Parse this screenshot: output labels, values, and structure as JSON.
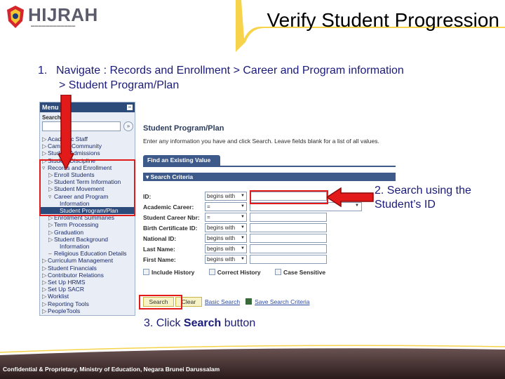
{
  "header": {
    "logo_text": "HIJRAH",
    "title": "Verify Student Progression"
  },
  "instruction": {
    "number": "1.",
    "prefix": "Navigate : ",
    "path_line1": "Records and Enrollment > Career and Program information",
    "path_line2": "> Student Program/Plan"
  },
  "menu": {
    "title": "Menu",
    "search_label": "Search:",
    "items": [
      {
        "marker": "▷",
        "label": "Academic Staff",
        "level": 0
      },
      {
        "marker": "▷",
        "label": "Campus Community",
        "level": 0
      },
      {
        "marker": "▷",
        "label": "Student Admissions",
        "level": 0
      },
      {
        "marker": "▷",
        "label": "Student Discipline",
        "level": 0
      },
      {
        "marker": "▿",
        "label": "Records and Enrollment",
        "level": 0
      },
      {
        "marker": "▷",
        "label": "Enroll Students",
        "level": 1
      },
      {
        "marker": "▷",
        "label": "Student Term Information",
        "level": 1
      },
      {
        "marker": "▷",
        "label": "Student Movement",
        "level": 1
      },
      {
        "marker": "▿",
        "label": "Career and Program",
        "level": 1
      },
      {
        "marker": "",
        "label": "Information",
        "level": 2
      },
      {
        "marker": "–",
        "label": "Student Program/Plan",
        "level": 2,
        "selected": true
      },
      {
        "marker": "▷",
        "label": "Enrollment Summaries",
        "level": 1
      },
      {
        "marker": "▷",
        "label": "Term Processing",
        "level": 1
      },
      {
        "marker": "▷",
        "label": "Graduation",
        "level": 1
      },
      {
        "marker": "▷",
        "label": "Student Background",
        "level": 1
      },
      {
        "marker": "",
        "label": "Information",
        "level": 2
      },
      {
        "marker": "–",
        "label": "Religious Education Details",
        "level": 1
      },
      {
        "marker": "▷",
        "label": "Curriculum Management",
        "level": 0
      },
      {
        "marker": "▷",
        "label": "Student Financials",
        "level": 0
      },
      {
        "marker": "▷",
        "label": "Contributor Relations",
        "level": 0
      },
      {
        "marker": "▷",
        "label": "Set Up HRMS",
        "level": 0
      },
      {
        "marker": "▷",
        "label": "Set Up SACR",
        "level": 0
      },
      {
        "marker": "▷",
        "label": "Worklist",
        "level": 0
      },
      {
        "marker": "▷",
        "label": "Reporting Tools",
        "level": 0
      },
      {
        "marker": "▷",
        "label": "PeopleTools",
        "level": 0
      }
    ]
  },
  "panel": {
    "title": "Student Program/Plan",
    "description": "Enter any information you have and click Search. Leave fields blank for a list of all values.",
    "tab_label": "Find an Existing Value",
    "criteria_label": "▾ Search Criteria",
    "fields": [
      {
        "label": "ID:",
        "operator": "begins with",
        "value_width": "wide"
      },
      {
        "label": "Academic Career:",
        "operator": "=",
        "value_width": "select"
      },
      {
        "label": "Student Career Nbr:",
        "operator": "=",
        "value_width": "wide"
      },
      {
        "label": "Birth Certificate ID:",
        "operator": "begins with",
        "value_width": "wide"
      },
      {
        "label": "National ID:",
        "operator": "begins with",
        "value_width": "wide"
      },
      {
        "label": "Last Name:",
        "operator": "begins with",
        "value_width": "wide"
      },
      {
        "label": "First Name:",
        "operator": "begins with",
        "value_width": "wide"
      }
    ],
    "checkboxes": [
      "Include History",
      "Correct History",
      "Case Sensitive"
    ],
    "search_button": "Search",
    "clear_button": "Clear",
    "basic_search_link": "Basic Search",
    "save_criteria_link": "Save Search Criteria"
  },
  "callouts": {
    "step2": "2. Search using the Student’s ID",
    "step3_prefix": "3. Click ",
    "step3_bold": "Search",
    "step3_suffix": " button"
  },
  "footer": {
    "text": "Confidential & Proprietary, Ministry of Education, Negara Brunei Darussalam"
  },
  "colors": {
    "accent_red": "#e21a1a",
    "banner_yellow": "#f6d34a",
    "footer_dark": "#3a2a2a",
    "text_navy": "#1a1a7a"
  }
}
